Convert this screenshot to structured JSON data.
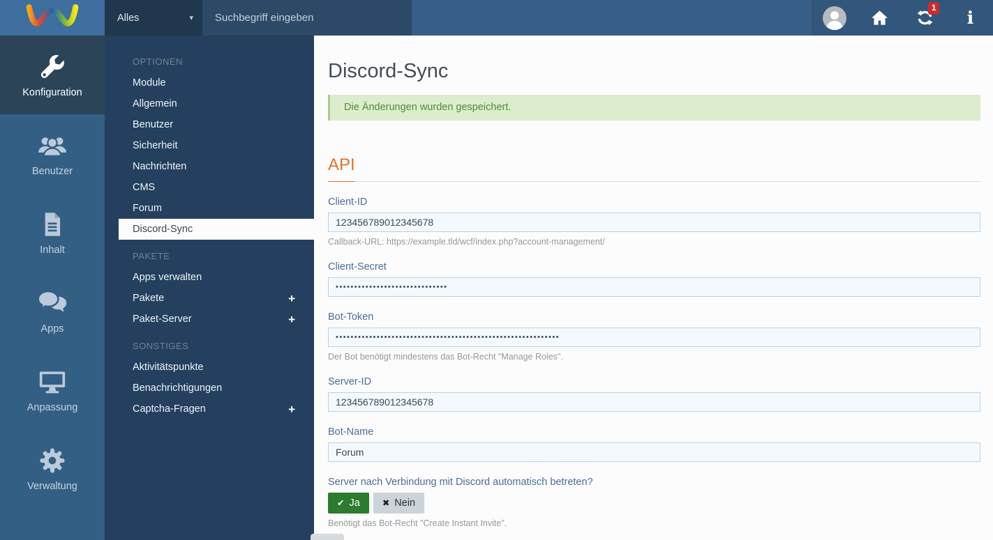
{
  "topbar": {
    "search_scope": "Alles",
    "search_placeholder": "Suchbegriff eingeben",
    "notification_count": "1"
  },
  "icons": {
    "caret_down": "▾",
    "plus": "+",
    "check": "✔",
    "close": "✖",
    "info": "i"
  },
  "sidebar": {
    "items": [
      {
        "label": "Konfiguration",
        "icon": "wrench",
        "active": true
      },
      {
        "label": "Benutzer",
        "icon": "users",
        "active": false
      },
      {
        "label": "Inhalt",
        "icon": "file-text",
        "active": false
      },
      {
        "label": "Apps",
        "icon": "comments",
        "active": false
      },
      {
        "label": "Anpassung",
        "icon": "desktop",
        "active": false
      },
      {
        "label": "Verwaltung",
        "icon": "gear",
        "active": false
      }
    ]
  },
  "menu": {
    "sections": [
      {
        "title": "OPTIONEN",
        "items": [
          {
            "label": "Module"
          },
          {
            "label": "Allgemein"
          },
          {
            "label": "Benutzer"
          },
          {
            "label": "Sicherheit"
          },
          {
            "label": "Nachrichten"
          },
          {
            "label": "CMS"
          },
          {
            "label": "Forum"
          },
          {
            "label": "Discord-Sync",
            "active": true
          }
        ]
      },
      {
        "title": "PAKETE",
        "items": [
          {
            "label": "Apps verwalten"
          },
          {
            "label": "Pakete",
            "expandable": true
          },
          {
            "label": "Paket-Server",
            "expandable": true
          }
        ]
      },
      {
        "title": "SONSTIGES",
        "items": [
          {
            "label": "Aktivitätspunkte"
          },
          {
            "label": "Benachrichtigungen"
          },
          {
            "label": "Captcha-Fragen",
            "expandable": true
          }
        ]
      }
    ]
  },
  "content": {
    "title": "Discord-Sync",
    "success_message": "Die Änderungen wurden gespeichert.",
    "section_title": "API",
    "fields": [
      {
        "label": "Client-ID",
        "value": "123456789012345678",
        "help": "Callback-URL: https://example.tld/wcf/index.php?account-management/"
      },
      {
        "label": "Client-Secret",
        "value": "••••••••••••••••••••••••••••••"
      },
      {
        "label": "Bot-Token",
        "value": "••••••••••••••••••••••••••••••••••••••••••••••••••••••••••••",
        "help": "Der Bot benötigt mindestens das Bot-Recht \"Manage Roles\"."
      },
      {
        "label": "Server-ID",
        "value": "123456789012345678"
      },
      {
        "label": "Bot-Name",
        "value": "Forum"
      }
    ],
    "toggle": {
      "label": "Server nach Verbindung mit Discord automatisch betreten?",
      "yes": "Ja",
      "no": "Nein",
      "selected": "Ja",
      "help": "Benötigt das Bot-Recht \"Create Instant Invite\"."
    }
  },
  "colors": {
    "topbar_blue": "#375e86",
    "brand_blue": "#3e6f9f",
    "sidebar_blue": "#335f85",
    "menu_navy": "#24405e",
    "accent_orange": "#e0722a",
    "success_bg": "#dcedcd",
    "success_text": "#4f8b3b",
    "badge_red": "#c62d2d",
    "yes_green": "#2c7b30",
    "label_blue": "#4c6d96"
  }
}
